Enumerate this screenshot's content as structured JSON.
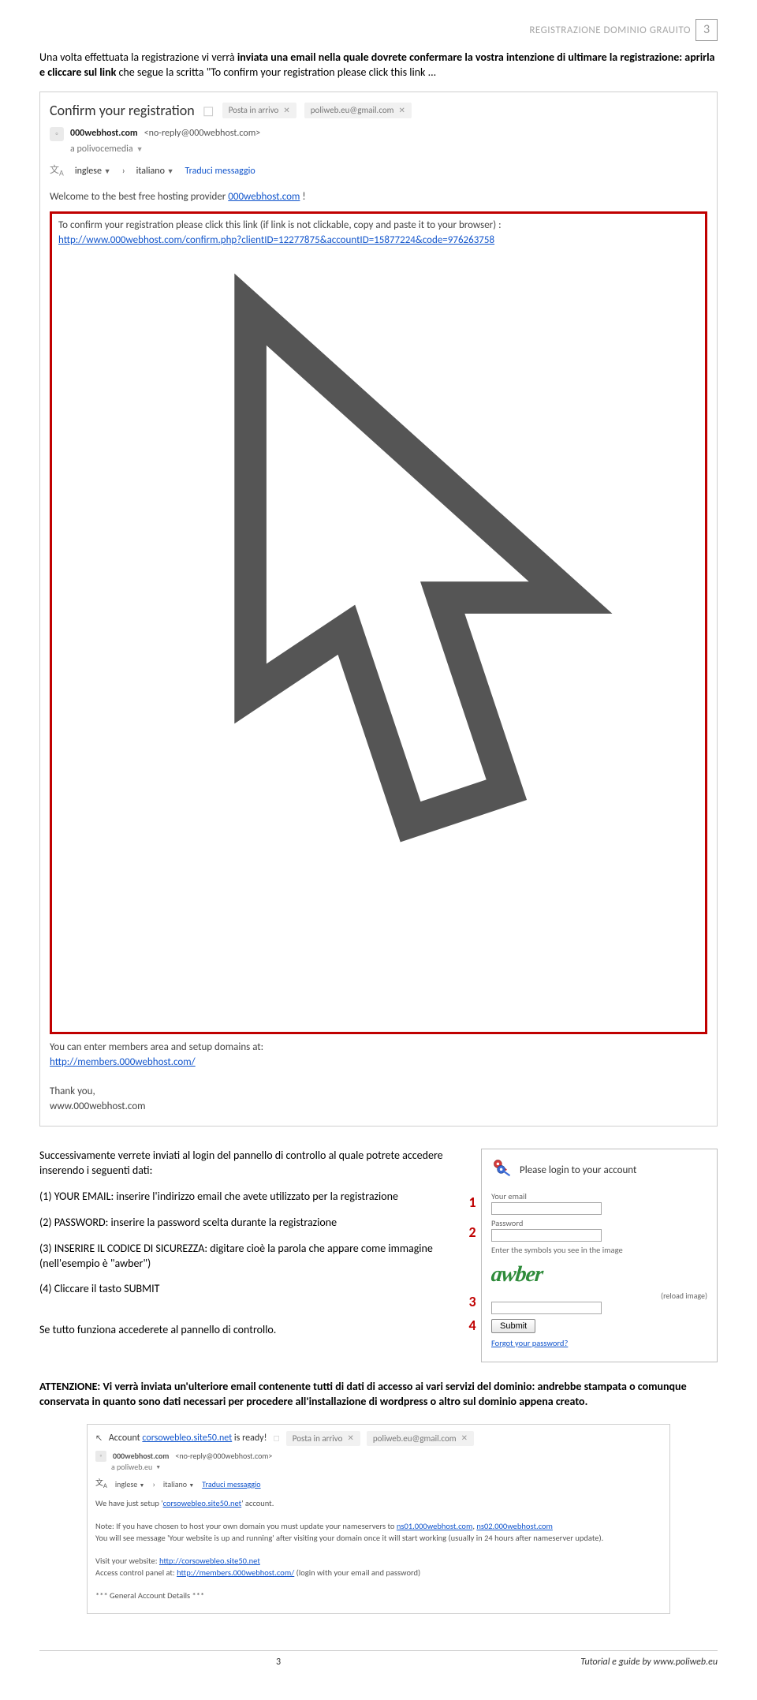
{
  "header": {
    "title": "REGISTRAZIONE DOMINIO GRAUITO",
    "pageNumber": "3"
  },
  "intro": {
    "pre": "Una volta effettuata la registrazione vi verrà ",
    "b1": "inviata una email nella quale dovrete confermare la vostra intenzione di ultimare la registrazione: aprirla e cliccare sul link",
    "mid": " che segue la scritta \"To confirm your registration please click this link ..."
  },
  "email1": {
    "subject": "Confirm your registration",
    "chipInbox": "Posta in arrivo",
    "chipAddr": "poliweb.eu@gmail.com",
    "senderName": "000webhost.com",
    "senderAddr": "<no-reply@000webhost.com>",
    "recipient": "a polivocemedia",
    "langFrom": "inglese",
    "langTo": "italiano",
    "translate": "Traduci messaggio",
    "welcome_a": "Welcome to the best free hosting provider ",
    "welcome_link": "000webhost.com",
    "welcome_b": " !",
    "confirmText": "To confirm your registration please click this link (if link is not clickable, copy and paste it to your browser) :",
    "confirmLink": "http://www.000webhost.com/confirm.php?clientID=12277875&accountID=15877224&code=976263758",
    "members_a": "You can enter members area and setup domains at:",
    "members_link": "http://members.000webhost.com/",
    "thanks": "Thank you,",
    "sign": "www.000webhost.com"
  },
  "steps": {
    "intro_a": "Successivamente verrete inviati al login del pannello di controllo al quale potrete accedere inserendo i seguenti dati:",
    "s1": "(1) YOUR EMAIL: inserire l'indirizzo email che avete utilizzato per la registrazione",
    "s2": "(2) PASSWORD: inserire la password scelta durante la registrazione",
    "s3": "(3) INSERIRE IL CODICE DI SICUREZZA: digitare cioè la parola che appare come immagine (nell'esempio è \"awber\")",
    "s4": "(4) Cliccare il tasto SUBMIT",
    "ok": "Se tutto funziona accederete al pannello di controllo."
  },
  "login": {
    "title": "Please login to your account",
    "lblEmail": "Your email",
    "lblPass": "Password",
    "lblSym": "Enter the symbols you see in the image",
    "captcha": "awber",
    "reload": "(reload image)",
    "submit": "Submit",
    "forgot": "Forgot your password?"
  },
  "markers": {
    "n1": "1",
    "n2": "2",
    "n3": "3",
    "n4": "4"
  },
  "attn": {
    "b": "ATTENZIONE: Vi verrà inviata un'ulteriore email  contenente tutti di dati di accesso ai vari servizi del dominio: andrebbe stampata o comunque conservata in quanto sono dati necessari per procedere all'installazione di wordpress o altro sul dominio appena creato."
  },
  "email2": {
    "subj_a": "Account ",
    "subj_link": "corsowebleo.site50.net",
    "subj_b": " is ready!",
    "chipInbox": "Posta in arrivo",
    "chipAddr": "poliweb.eu@gmail.com",
    "senderName": "000webhost.com",
    "senderAddr": "<no-reply@000webhost.com>",
    "recipient": "a poliweb.eu",
    "langFrom": "inglese",
    "langTo": "italiano",
    "translate": "Traduci messaggio",
    "l1_a": "We have just setup '",
    "l1_link": "corsowebleo.site50.net",
    "l1_b": "' account.",
    "note_a": "Note: If you have chosen to host your own domain you must update your nameservers to ",
    "ns1": "ns01.000webhost.com",
    "ns2": "ns02.000webhost.com",
    "note_b": "You will see message 'Your website is up and running' after visiting your domain once it will start working (usually in 24 hours after nameserver update).",
    "visit_a": "Visit your website: ",
    "visit_link": "http://corsowebleo.site50.net",
    "acp_a": "Access control panel at: ",
    "acp_link": "http://members.000webhost.com/",
    "acp_b": " (login with your email and password)",
    "gad": "*** General Account Details ***"
  },
  "footer": {
    "page": "3",
    "credit": "Tutorial e guide by www.poliweb.eu"
  }
}
